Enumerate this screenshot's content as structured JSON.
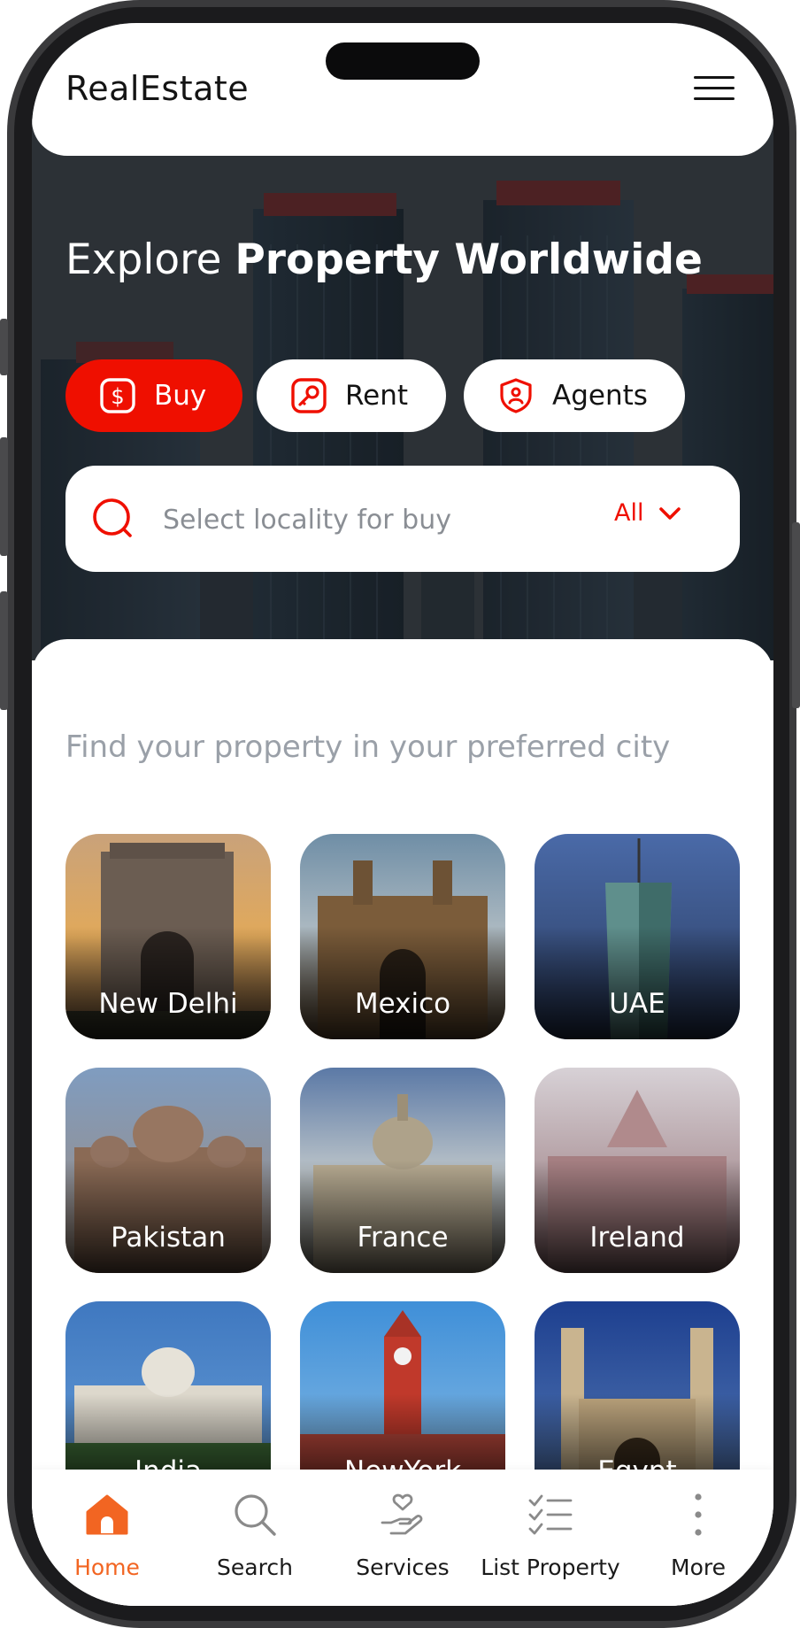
{
  "app": {
    "brand": "RealEstate"
  },
  "hero": {
    "headline_light": "Explore",
    "headline_bold": "Property Worldwide"
  },
  "tabs": [
    {
      "label": "Buy",
      "icon": "dollar-icon",
      "active": true
    },
    {
      "label": "Rent",
      "icon": "key-icon",
      "active": false
    },
    {
      "label": "Agents",
      "icon": "agent-badge-icon",
      "active": false
    }
  ],
  "search": {
    "placeholder": "Select locality for buy",
    "value": "",
    "filter_label": "All"
  },
  "section": {
    "subtitle": "Find your property in your preferred city"
  },
  "cities": [
    {
      "name": "New Delhi"
    },
    {
      "name": "Mexico"
    },
    {
      "name": "UAE"
    },
    {
      "name": "Pakistan"
    },
    {
      "name": "France"
    },
    {
      "name": "Ireland"
    },
    {
      "name": "India"
    },
    {
      "name": "NewYork"
    },
    {
      "name": "Egypt"
    }
  ],
  "nav": [
    {
      "label": "Home",
      "icon": "home-icon",
      "active": true
    },
    {
      "label": "Search",
      "icon": "search-icon",
      "active": false
    },
    {
      "label": "Services",
      "icon": "services-icon",
      "active": false
    },
    {
      "label": "List Property",
      "icon": "list-icon",
      "active": false
    },
    {
      "label": "More",
      "icon": "more-icon",
      "active": false
    }
  ],
  "colors": {
    "accent": "#ef0f00",
    "nav_active": "#f26522",
    "muted_text": "#9aa0a8"
  }
}
